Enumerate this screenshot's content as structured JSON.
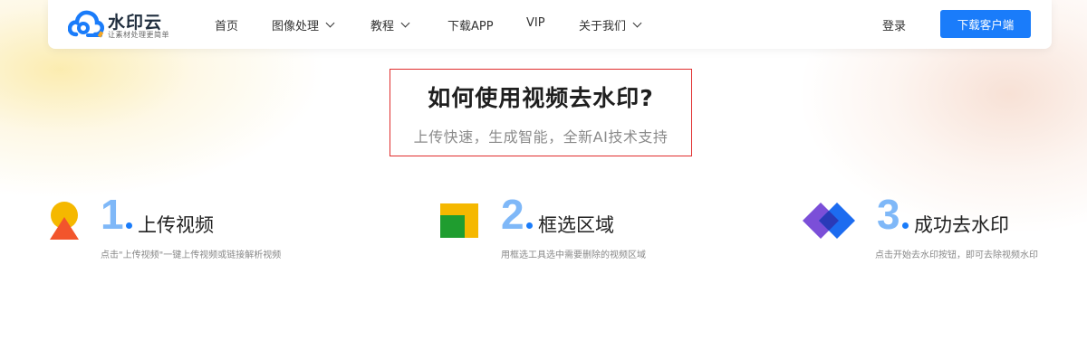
{
  "brand": {
    "name": "水印云",
    "slogan": "让素材处理更简单"
  },
  "nav": {
    "items": [
      {
        "label": "首页",
        "has_dropdown": false
      },
      {
        "label": "图像处理",
        "has_dropdown": true
      },
      {
        "label": "教程",
        "has_dropdown": true
      },
      {
        "label": "下载APP",
        "has_dropdown": false
      },
      {
        "label": "VIP",
        "has_dropdown": false
      },
      {
        "label": "关于我们",
        "has_dropdown": true
      }
    ],
    "login_label": "登录",
    "download_label": "下载客户端"
  },
  "hero": {
    "title": "如何使用视频去水印?",
    "subtitle": "上传快速，生成智能，全新AI技术支持"
  },
  "steps": [
    {
      "number": "1",
      "title": "上传视频",
      "description": "点击\"上传视频\"一键上传视频或链接解析视频",
      "icon": "upload-shape-icon"
    },
    {
      "number": "2",
      "title": "框选区域",
      "description": "用框选工具选中需要删除的视频区域",
      "icon": "select-area-icon"
    },
    {
      "number": "3",
      "title": "成功去水印",
      "description": "点击开始去水印按钮，即可去除视频水印",
      "icon": "diamond-layers-icon"
    }
  ],
  "colors": {
    "accent": "#1a7cfa",
    "step_number": "#7fb8f8",
    "highlight_border": "#e02d2d"
  }
}
